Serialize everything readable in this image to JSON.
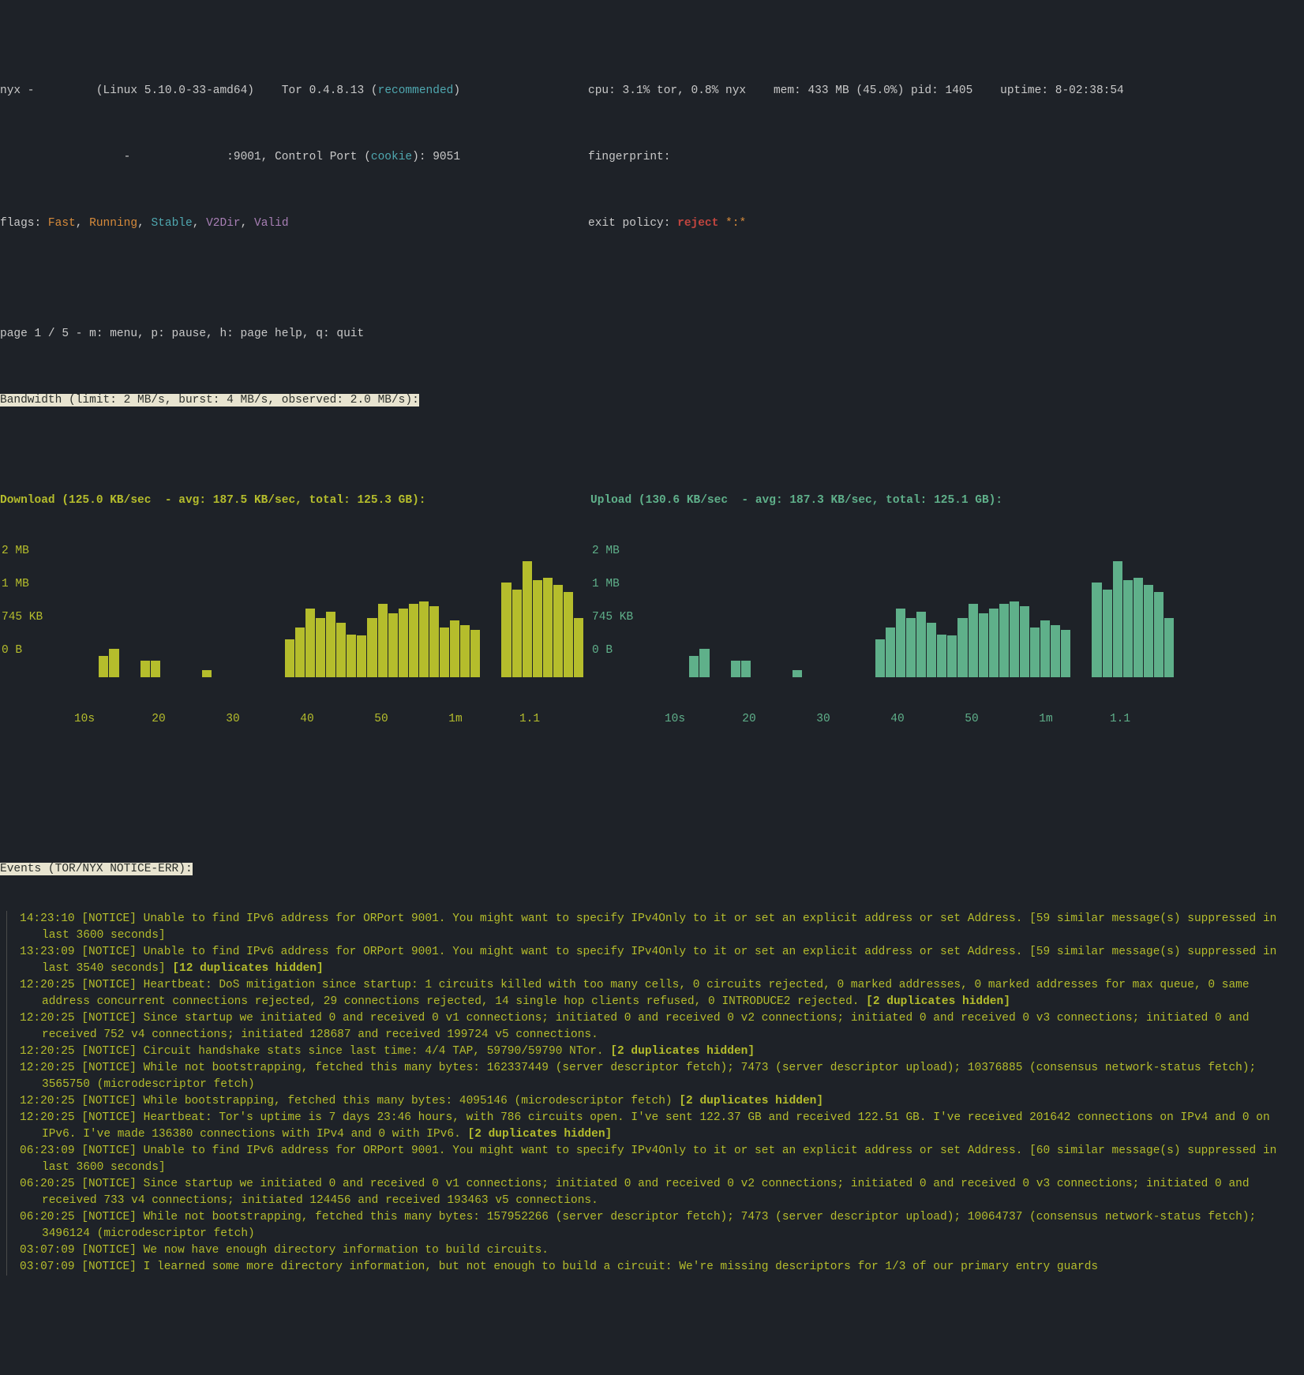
{
  "header": {
    "app": "nyx -",
    "os": "(Linux 5.10.0-33-amd64)",
    "tor_version": "Tor 0.4.8.13 (",
    "recommended": "recommended",
    "tor_version_end": ")",
    "dash": "-",
    "port_label": ":9001, Control Port (",
    "cookie": "cookie",
    "port_end": "): 9051",
    "flags_label": "flags: ",
    "flag_fast": "Fast",
    "flag_running": "Running",
    "flag_stable": "Stable",
    "flag_v2dir": "V2Dir",
    "flag_valid": "Valid",
    "cpu": "cpu: 3.1% tor, 0.8% nyx",
    "mem": "mem: 433 MB (45.0%)",
    "pid": "pid: 1405",
    "uptime": "uptime: 8-02:38:54",
    "fingerprint": "fingerprint:",
    "exit_label": "exit policy: ",
    "exit_policy": "reject ",
    "exit_star": "*:*"
  },
  "nav": "page 1 / 5 - m: menu, p: pause, h: page help, q: quit",
  "bandwidth_header": "Bandwidth (limit: 2 MB/s, burst: 4 MB/s, observed: 2.0 MB/s):",
  "download_line": "Download (125.0 KB/sec  - avg: 187.5 KB/sec, total: 125.3 GB):",
  "upload_line": "Upload (130.6 KB/sec  - avg: 187.3 KB/sec, total: 125.1 GB):",
  "ylabels": [
    "2 MB",
    "1 MB",
    "745 KB",
    "0 B"
  ],
  "xlabels": [
    "10s",
    "20",
    "30",
    "40",
    "50",
    "1m",
    "1.1"
  ],
  "events_header": "Events (TOR/NYX NOTICE-ERR):",
  "chart_data": [
    {
      "type": "bar",
      "panel": "Download",
      "ylim_bytes": [
        0,
        2097152
      ],
      "ylabels": [
        "0 B",
        "745 KB",
        "1 MB",
        "2 MB"
      ],
      "xticks": [
        "10s",
        "20",
        "30",
        "40",
        "50",
        "1m",
        "1.1"
      ],
      "values_pct_of_2MB": [
        0,
        0,
        0,
        0,
        0,
        18,
        24,
        0,
        0,
        14,
        14,
        0,
        0,
        0,
        0,
        6,
        0,
        0,
        0,
        0,
        0,
        0,
        0,
        32,
        42,
        58,
        50,
        55,
        46,
        36,
        35,
        50,
        62,
        54,
        58,
        62,
        64,
        60,
        42,
        48,
        44,
        40,
        0,
        0,
        80,
        74,
        98,
        82,
        84,
        78,
        72,
        50
      ]
    },
    {
      "type": "bar",
      "panel": "Upload",
      "ylim_bytes": [
        0,
        2097152
      ],
      "ylabels": [
        "0 B",
        "745 KB",
        "1 MB",
        "2 MB"
      ],
      "xticks": [
        "10s",
        "20",
        "30",
        "40",
        "50",
        "1m",
        "1.1"
      ],
      "values_pct_of_2MB": [
        0,
        0,
        0,
        0,
        0,
        18,
        24,
        0,
        0,
        14,
        14,
        0,
        0,
        0,
        0,
        6,
        0,
        0,
        0,
        0,
        0,
        0,
        0,
        32,
        42,
        58,
        50,
        55,
        46,
        36,
        35,
        50,
        62,
        54,
        58,
        62,
        64,
        60,
        42,
        48,
        44,
        40,
        0,
        0,
        80,
        74,
        98,
        82,
        84,
        78,
        72,
        50
      ]
    }
  ],
  "events": [
    {
      "text": "14:23:10 [NOTICE] Unable to find IPv6 address for ORPort 9001. You might want to specify IPv4Only to it or set an explicit address or set Address. [59 similar message(s) suppressed in last 3600 seconds]",
      "dup": ""
    },
    {
      "text": "13:23:09 [NOTICE] Unable to find IPv6 address for ORPort 9001. You might want to specify IPv4Only to it or set an explicit address or set Address. [59 similar message(s) suppressed in last 3540 seconds] ",
      "dup": "[12 duplicates hidden]"
    },
    {
      "text": "12:20:25 [NOTICE] Heartbeat: DoS mitigation since startup: 1 circuits killed with too many cells, 0 circuits rejected, 0 marked addresses, 0 marked addresses for max queue, 0 same address concurrent connections rejected, 29 connections rejected, 14 single hop clients refused, 0 INTRODUCE2 rejected. ",
      "dup": "[2 duplicates hidden]"
    },
    {
      "text": "12:20:25 [NOTICE] Since startup we initiated 0 and received 0 v1 connections; initiated 0 and received 0 v2 connections; initiated 0 and received 0 v3 connections; initiated 0 and received 752 v4 connections; initiated 128687 and received 199724 v5 connections.",
      "dup": ""
    },
    {
      "text": "12:20:25 [NOTICE] Circuit handshake stats since last time: 4/4 TAP, 59790/59790 NTor. ",
      "dup": "[2 duplicates hidden]"
    },
    {
      "text": "12:20:25 [NOTICE] While not bootstrapping, fetched this many bytes: 162337449 (server descriptor fetch); 7473 (server descriptor upload); 10376885 (consensus network-status fetch); 3565750 (microdescriptor fetch)",
      "dup": ""
    },
    {
      "text": "12:20:25 [NOTICE] While bootstrapping, fetched this many bytes: 4095146 (microdescriptor fetch) ",
      "dup": "[2 duplicates hidden]"
    },
    {
      "text": "12:20:25 [NOTICE] Heartbeat: Tor's uptime is 7 days 23:46 hours, with 786 circuits open. I've sent 122.37 GB and received 122.51 GB. I've received 201642 connections on IPv4 and 0 on IPv6. I've made 136380 connections with IPv4 and 0 with IPv6. ",
      "dup": "[2 duplicates hidden]"
    },
    {
      "text": "06:23:09 [NOTICE] Unable to find IPv6 address for ORPort 9001. You might want to specify IPv4Only to it or set an explicit address or set Address. [60 similar message(s) suppressed in last 3600 seconds]",
      "dup": ""
    },
    {
      "text": "06:20:25 [NOTICE] Since startup we initiated 0 and received 0 v1 connections; initiated 0 and received 0 v2 connections; initiated 0 and received 0 v3 connections; initiated 0 and received 733 v4 connections; initiated 124456 and received 193463 v5 connections.",
      "dup": ""
    },
    {
      "text": "06:20:25 [NOTICE] While not bootstrapping, fetched this many bytes: 157952266 (server descriptor fetch); 7473 (server descriptor upload); 10064737 (consensus network-status fetch); 3496124 (microdescriptor fetch)",
      "dup": ""
    },
    {
      "text": "03:07:09 [NOTICE] We now have enough directory information to build circuits.",
      "dup": ""
    },
    {
      "text": "03:07:09 [NOTICE] I learned some more directory information, but not enough to build a circuit: We're missing descriptors for 1/3 of our primary entry guards",
      "dup": ""
    }
  ]
}
